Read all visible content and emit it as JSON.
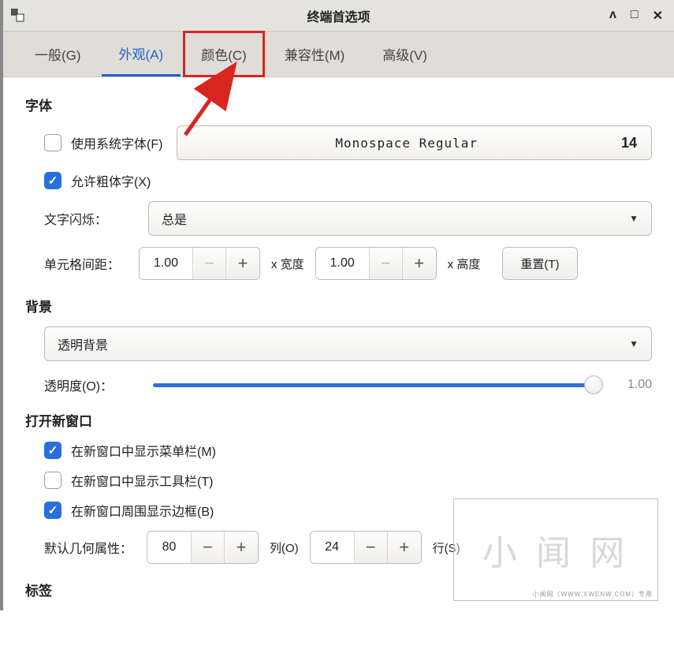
{
  "window": {
    "title": "终端首选项"
  },
  "tabs": {
    "general": "一般(G)",
    "appearance": "外观(A)",
    "color": "颜色(C)",
    "compat": "兼容性(M)",
    "advanced": "高级(V)"
  },
  "font_section": {
    "title": "字体",
    "use_system_font": "使用系统字体(F)",
    "font_name": "Monospace Regular",
    "font_size": "14",
    "allow_bold": "允许粗体字(X)",
    "blink_label": "文字闪烁：",
    "blink_value": "总是",
    "spacing_label": "单元格间距：",
    "width_val": "1.00",
    "width_lbl": "x 宽度",
    "height_val": "1.00",
    "height_lbl": "x 高度",
    "reset": "重置(T)"
  },
  "bg_section": {
    "title": "背景",
    "mode": "透明背景",
    "opacity_label": "透明度(O)：",
    "opacity_value": "1.00"
  },
  "newwin_section": {
    "title": "打开新窗口",
    "show_menubar": "在新窗口中显示菜单栏(M)",
    "show_toolbar": "在新窗口中显示工具栏(T)",
    "show_border": "在新窗口周围显示边框(B)",
    "geometry_label": "默认几何属性：",
    "cols": "80",
    "cols_lbl": "列(O)",
    "rows": "24",
    "rows_lbl": "行(S)"
  },
  "tabs_section": {
    "title": "标签"
  },
  "watermark": {
    "main": "小 闻 网",
    "sub": "小闻网（WWW.XWENW.COM）专用"
  }
}
